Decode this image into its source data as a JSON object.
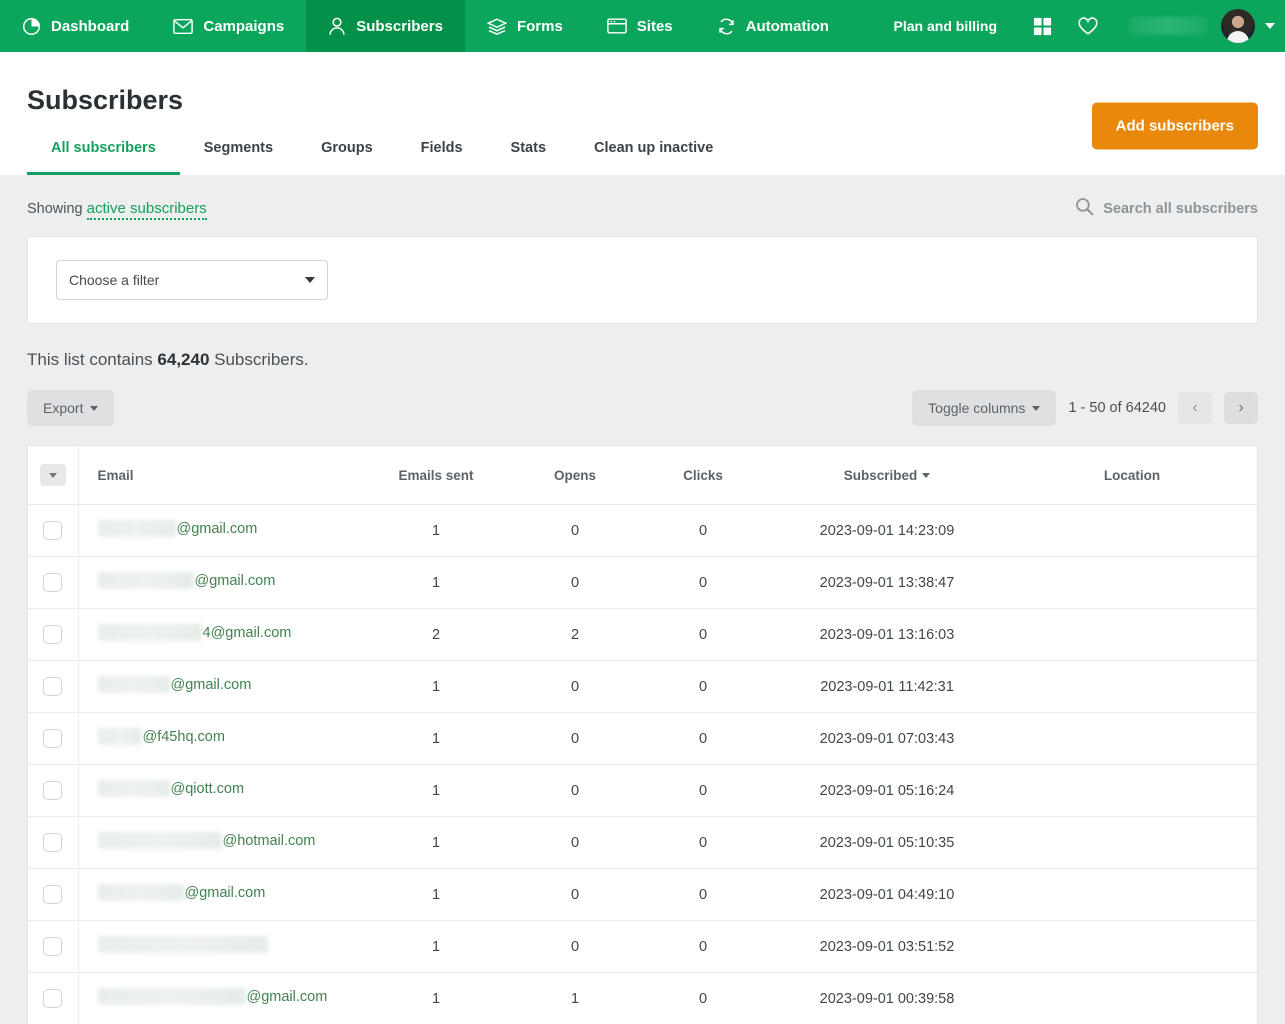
{
  "navbar": {
    "items": [
      {
        "label": "Dashboard",
        "icon": "pie-chart-icon",
        "active": false
      },
      {
        "label": "Campaigns",
        "icon": "envelope-icon",
        "active": false
      },
      {
        "label": "Subscribers",
        "icon": "person-icon",
        "active": true
      },
      {
        "label": "Forms",
        "icon": "layers-icon",
        "active": false
      },
      {
        "label": "Sites",
        "icon": "browser-window-icon",
        "active": false
      },
      {
        "label": "Automation",
        "icon": "refresh-cycle-icon",
        "active": false
      }
    ],
    "plan_billing": "Plan and billing",
    "grid_icon": "grid-apps-icon",
    "heart_icon": "heart-icon",
    "account_icon": "user-avatar",
    "account_caret": "chevron-down-icon",
    "bg_color": "#0ba55c",
    "active_bg_color": "#039048"
  },
  "page": {
    "title": "Subscribers",
    "add_button": "Add subscribers",
    "add_button_color": "#e8890c",
    "tabs": [
      {
        "label": "All subscribers",
        "active": true
      },
      {
        "label": "Segments",
        "active": false
      },
      {
        "label": "Groups",
        "active": false
      },
      {
        "label": "Fields",
        "active": false
      },
      {
        "label": "Stats",
        "active": false
      },
      {
        "label": "Clean up inactive",
        "active": false
      }
    ]
  },
  "showing": {
    "prefix": "Showing",
    "link": "active subscribers",
    "search_label": "Search all subscribers",
    "search_icon": "search-icon"
  },
  "filter": {
    "placeholder": "Choose a filter",
    "caret_icon": "chevron-down-icon"
  },
  "summary": {
    "prefix": "This list contains",
    "count": "64,240",
    "suffix": "Subscribers."
  },
  "toolbar": {
    "export_label": "Export",
    "toggle_columns_label": "Toggle columns",
    "page_range": "1 - 50 of 64240",
    "prev_icon": "chevron-left-icon",
    "next_icon": "chevron-right-icon",
    "prev_glyph": "‹",
    "next_glyph": "›"
  },
  "table": {
    "select_all_icon": "chevron-down-icon",
    "columns": [
      "Email",
      "Emails sent",
      "Opens",
      "Clicks",
      "Subscribed",
      "Location"
    ],
    "sorted_column": "Subscribed",
    "rows": [
      {
        "email_redacted_width": 78,
        "email_domain": "@gmail.com",
        "emails_sent": "1",
        "opens": "0",
        "clicks": "0",
        "subscribed": "2023-09-01 14:23:09",
        "location": ""
      },
      {
        "email_redacted_width": 96,
        "email_domain": "@gmail.com",
        "emails_sent": "1",
        "opens": "0",
        "clicks": "0",
        "subscribed": "2023-09-01 13:38:47",
        "location": ""
      },
      {
        "email_redacted_width": 104,
        "email_domain": "4@gmail.com",
        "emails_sent": "2",
        "opens": "2",
        "clicks": "0",
        "subscribed": "2023-09-01 13:16:03",
        "location": ""
      },
      {
        "email_redacted_width": 72,
        "email_domain": "@gmail.com",
        "emails_sent": "1",
        "opens": "0",
        "clicks": "0",
        "subscribed": "2023-09-01 11:42:31",
        "location": ""
      },
      {
        "email_redacted_width": 44,
        "email_domain": "@f45hq.com",
        "emails_sent": "1",
        "opens": "0",
        "clicks": "0",
        "subscribed": "2023-09-01 07:03:43",
        "location": ""
      },
      {
        "email_redacted_width": 72,
        "email_domain": "@qiott.com",
        "emails_sent": "1",
        "opens": "0",
        "clicks": "0",
        "subscribed": "2023-09-01 05:16:24",
        "location": ""
      },
      {
        "email_redacted_width": 124,
        "email_domain": "@hotmail.com",
        "emails_sent": "1",
        "opens": "0",
        "clicks": "0",
        "subscribed": "2023-09-01 05:10:35",
        "location": ""
      },
      {
        "email_redacted_width": 86,
        "email_domain": "@gmail.com",
        "emails_sent": "1",
        "opens": "0",
        "clicks": "0",
        "subscribed": "2023-09-01 04:49:10",
        "location": ""
      },
      {
        "email_redacted_width": 170,
        "email_domain": "",
        "emails_sent": "1",
        "opens": "0",
        "clicks": "0",
        "subscribed": "2023-09-01 03:51:52",
        "location": ""
      },
      {
        "email_redacted_width": 148,
        "email_domain": "@gmail.com",
        "emails_sent": "1",
        "opens": "1",
        "clicks": "0",
        "subscribed": "2023-09-01 00:39:58",
        "location": ""
      }
    ]
  }
}
